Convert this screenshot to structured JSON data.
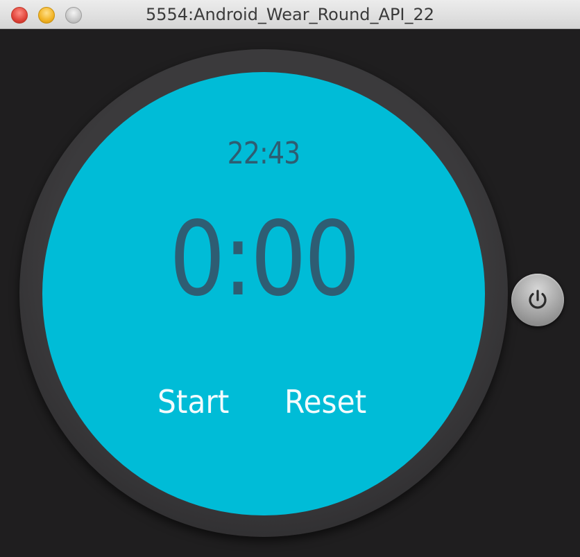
{
  "window": {
    "title": "5554:Android_Wear_Round_API_22"
  },
  "watch": {
    "clock_time": "22:43",
    "stopwatch": "0:00",
    "start_label": "Start",
    "reset_label": "Reset",
    "power_icon": "power-icon"
  },
  "colors": {
    "screen": "#00bcd7",
    "text_dark": "#2e5d73",
    "text_light": "#f3fbfd",
    "background": "#1f1e1f"
  }
}
